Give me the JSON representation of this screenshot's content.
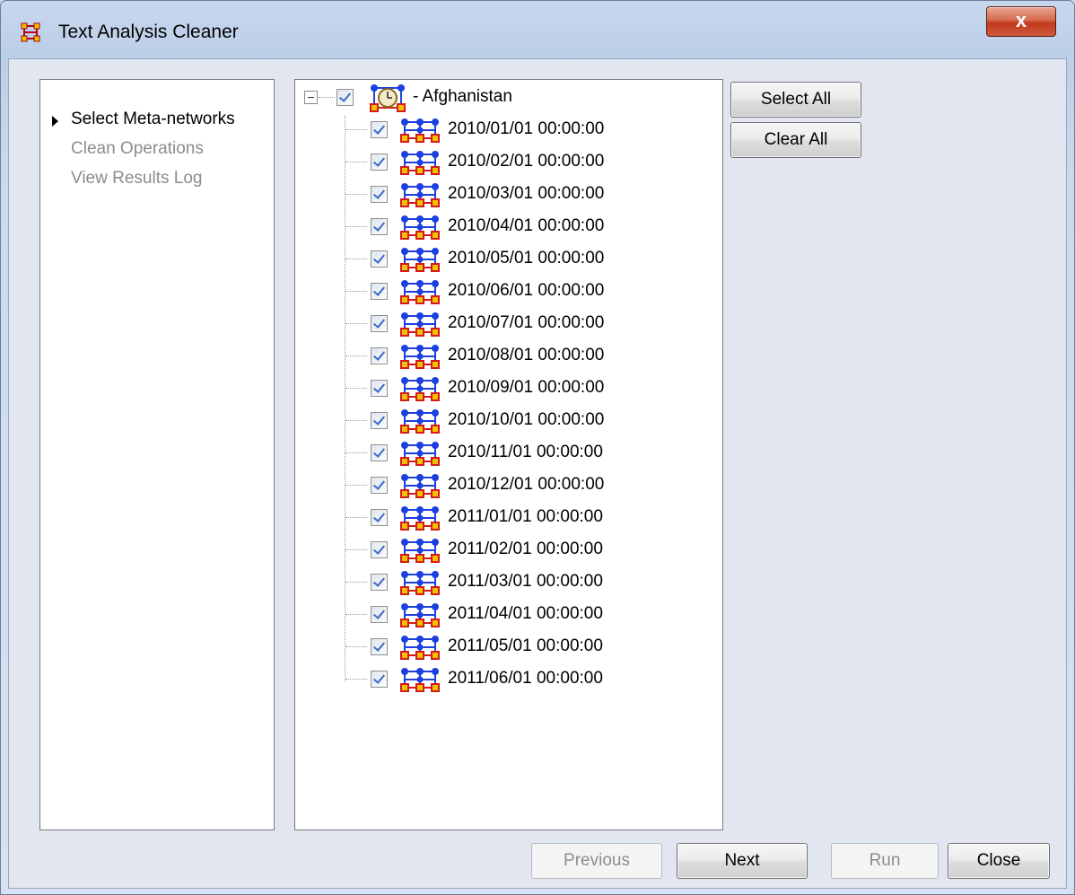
{
  "window": {
    "title": "Text Analysis Cleaner",
    "close_symbol": "x"
  },
  "nav": {
    "items": [
      {
        "label": "Select Meta-networks",
        "active": true
      },
      {
        "label": "Clean Operations",
        "active": false
      },
      {
        "label": "View Results Log",
        "active": false
      }
    ]
  },
  "tree": {
    "root": {
      "label": "- Afghanistan",
      "checked": true,
      "expanded": true,
      "icon": "meta-network-clock-icon"
    },
    "children": [
      {
        "label": "2010/01/01 00:00:00",
        "checked": true
      },
      {
        "label": "2010/02/01 00:00:00",
        "checked": true
      },
      {
        "label": "2010/03/01 00:00:00",
        "checked": true
      },
      {
        "label": "2010/04/01 00:00:00",
        "checked": true
      },
      {
        "label": "2010/05/01 00:00:00",
        "checked": true
      },
      {
        "label": "2010/06/01 00:00:00",
        "checked": true
      },
      {
        "label": "2010/07/01 00:00:00",
        "checked": true
      },
      {
        "label": "2010/08/01 00:00:00",
        "checked": true
      },
      {
        "label": "2010/09/01 00:00:00",
        "checked": true
      },
      {
        "label": "2010/10/01 00:00:00",
        "checked": true
      },
      {
        "label": "2010/11/01 00:00:00",
        "checked": true
      },
      {
        "label": "2010/12/01 00:00:00",
        "checked": true
      },
      {
        "label": "2011/01/01 00:00:00",
        "checked": true
      },
      {
        "label": "2011/02/01 00:00:00",
        "checked": true
      },
      {
        "label": "2011/03/01 00:00:00",
        "checked": true
      },
      {
        "label": "2011/04/01 00:00:00",
        "checked": true
      },
      {
        "label": "2011/05/01 00:00:00",
        "checked": true
      },
      {
        "label": "2011/06/01 00:00:00",
        "checked": true
      }
    ]
  },
  "side_buttons": {
    "select_all": "Select All",
    "clear_all": "Clear All"
  },
  "footer": {
    "previous": "Previous",
    "next": "Next",
    "run": "Run",
    "close": "Close"
  },
  "colors": {
    "node_blue": "#1d3fe0",
    "node_red": "#d61a1a",
    "node_yellow": "#f2c200"
  }
}
